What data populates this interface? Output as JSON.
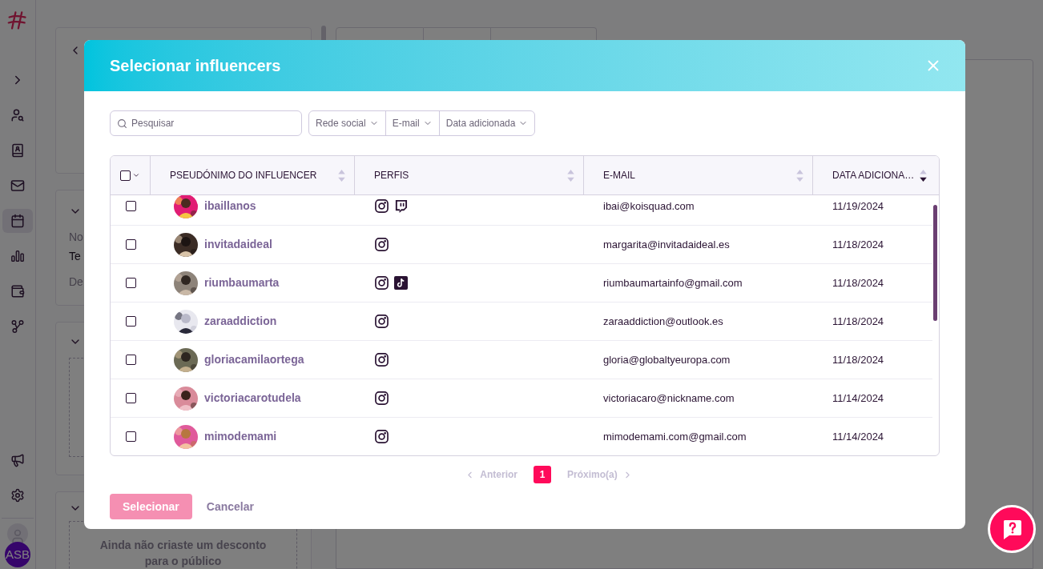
{
  "sidebar": {
    "items": [
      {
        "kind": "expand",
        "selected": false
      },
      {
        "kind": "user-search",
        "selected": false
      },
      {
        "kind": "contacts",
        "selected": false
      },
      {
        "kind": "mail",
        "selected": false
      },
      {
        "kind": "calendar",
        "selected": true
      },
      {
        "kind": "chart",
        "selected": false
      },
      {
        "kind": "wallet",
        "selected": false
      },
      {
        "kind": "nodes",
        "selected": false
      }
    ],
    "bottom_items": [
      {
        "kind": "megaphone",
        "selected": false
      },
      {
        "kind": "settings",
        "selected": false
      }
    ],
    "user_initials": "ASB"
  },
  "background": {
    "fields": [
      {
        "kind": "label",
        "text": "No"
      },
      {
        "kind": "value",
        "text": "Te"
      },
      {
        "kind": "label",
        "text": "De"
      }
    ],
    "empty_discount": "Ainda não criaste um desconto para o público"
  },
  "dialog": {
    "title": "Selecionar influencers",
    "search": {
      "placeholder": "Pesquisar"
    },
    "filters": [
      "Rede social",
      "E-mail",
      "Data adicionada"
    ],
    "table": {
      "select_all": {
        "checked": false
      },
      "columns": [
        {
          "label": "PSEUDÓNIMO DO INFLUENCER",
          "sorted_descending": false
        },
        {
          "label": "PERFIS",
          "sorted_descending": false
        },
        {
          "label": "E-MAIL",
          "sorted_descending": false
        },
        {
          "label": "DATA ADICIONA…",
          "sorted_descending": true
        }
      ],
      "rows": [
        {
          "checked": false,
          "name": "ibaillanos",
          "profiles": [
            {
              "kind": "instagram"
            },
            {
              "kind": "twitch"
            }
          ],
          "email": "ibai@koisquad.com",
          "date": "11/19/2024"
        },
        {
          "checked": false,
          "name": "invitadaideal",
          "profiles": [
            {
              "kind": "instagram"
            }
          ],
          "email": "margarita@invitadaideal.es",
          "date": "11/18/2024"
        },
        {
          "checked": false,
          "name": "riumbaumarta",
          "profiles": [
            {
              "kind": "instagram"
            },
            {
              "kind": "tiktok"
            }
          ],
          "email": "riumbaumartainfo@gmail.com",
          "date": "11/18/2024"
        },
        {
          "checked": false,
          "name": "zaraaddiction",
          "profiles": [
            {
              "kind": "instagram"
            }
          ],
          "email": "zaraaddiction@outlook.es",
          "date": "11/18/2024"
        },
        {
          "checked": false,
          "name": "gloriacamilaortega",
          "profiles": [
            {
              "kind": "instagram"
            }
          ],
          "email": "gloria@globaltyeuropa.com",
          "date": "11/18/2024"
        },
        {
          "checked": false,
          "name": "victoriacarotudela",
          "profiles": [
            {
              "kind": "instagram"
            }
          ],
          "email": "victoriacaro@nickname.com",
          "date": "11/14/2024"
        },
        {
          "checked": false,
          "name": "mimodemami",
          "profiles": [
            {
              "kind": "instagram"
            }
          ],
          "email": "mimodemami.com@gmail.com",
          "date": "11/14/2024"
        }
      ]
    },
    "pagination": {
      "previous": {
        "label": "Anterior",
        "disabled": true
      },
      "pages": [
        {
          "label": "1",
          "selected": true
        }
      ],
      "next": {
        "label": "Próximo(a)",
        "disabled": true
      }
    },
    "buttons": [
      {
        "kind": "primary",
        "label": "Selecionar",
        "disabled": true
      },
      {
        "kind": "link",
        "label": "Cancelar",
        "disabled": false
      }
    ]
  }
}
